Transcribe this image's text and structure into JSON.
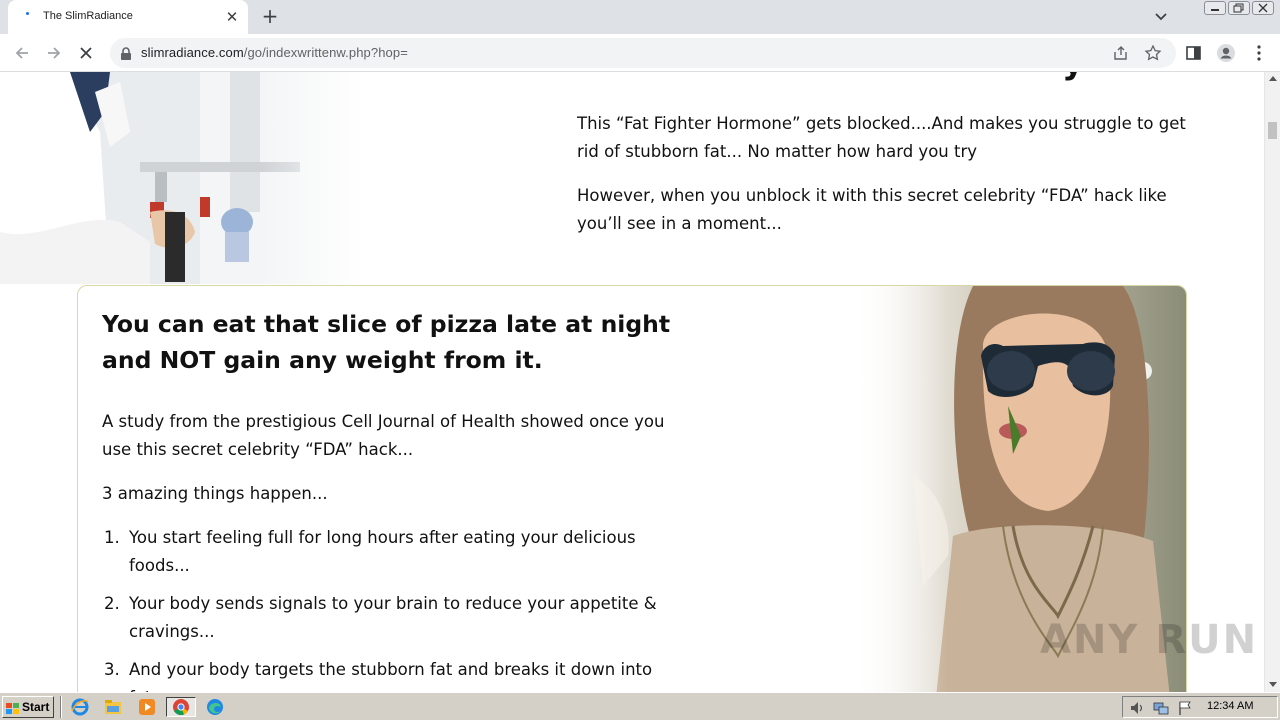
{
  "browser": {
    "tab_title": "The SlimRadiance",
    "tab_close": "✕",
    "new_tab": "+",
    "url_host": "slimradiance.com",
    "url_path": "/go/indexwrittenw.php?hop="
  },
  "page": {
    "cut_heading_fragment": "y",
    "intro_paragraphs": [
      "This “Fat Fighter Hormone” gets blocked....And makes you struggle to get rid of stubborn fat... No matter how hard you try",
      "However, when you unblock it with this secret celebrity “FDA” hack like you’ll see in a moment..."
    ],
    "card": {
      "headline": "You can eat that slice of pizza late at night and NOT gain any weight from it.",
      "paragraphs": [
        "A study from the prestigious Cell Journal of Health showed once you use this secret celebrity “FDA” hack...",
        "3 amazing things happen..."
      ],
      "list": [
        {
          "num": "1.",
          "text": "You start feeling full for long hours after eating your delicious foods..."
        },
        {
          "num": "2.",
          "text": "Your body sends signals to your brain to reduce your appetite & cravings..."
        },
        {
          "num": "3.",
          "text": "And your body targets the stubborn fat and breaks it down into fat..."
        }
      ]
    },
    "watermark": "ANY RUN"
  },
  "taskbar": {
    "start_label": "Start",
    "clock": "12:34 AM"
  },
  "colors": {
    "chrome_tabstrip": "#dee1e6",
    "card_border": "#d7d8a8",
    "text": "#111111",
    "taskbar": "#d4d0c8"
  }
}
